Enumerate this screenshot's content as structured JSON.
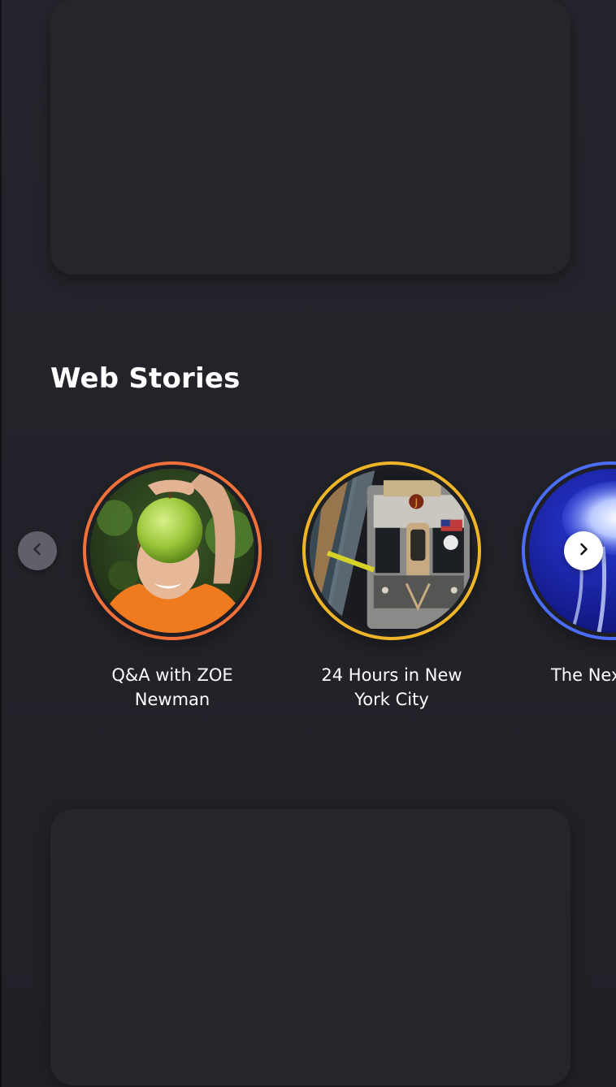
{
  "section": {
    "title": "Web Stories"
  },
  "stories": [
    {
      "label": "Q&A with ZOE Newman",
      "ring_color": "#f2713a",
      "image_icon": "woman-holding-apple-image"
    },
    {
      "label": "24 Hours in New York City",
      "ring_color": "#f0b429",
      "image_icon": "subway-train-image"
    },
    {
      "label": "The Next K Se",
      "ring_color": "#4a6cf7",
      "image_icon": "jellyfish-image"
    }
  ],
  "nav": {
    "prev_icon": "chevron-left-icon",
    "next_icon": "chevron-right-icon"
  },
  "colors": {
    "background": "#22232a",
    "card": "#25262b",
    "text": "#ffffff"
  }
}
